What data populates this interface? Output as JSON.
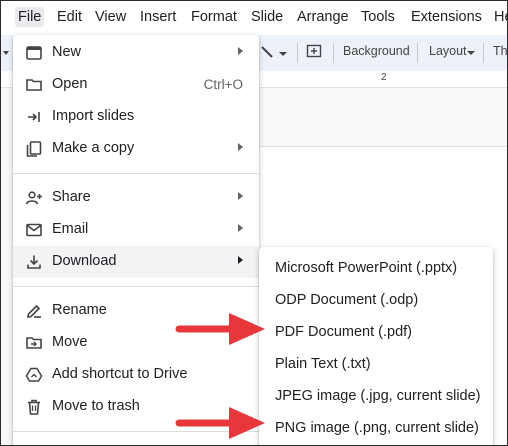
{
  "menubar": {
    "items": [
      "File",
      "Edit",
      "View",
      "Insert",
      "Format",
      "Slide",
      "Arrange",
      "Tools",
      "Extensions",
      "He"
    ]
  },
  "toolbar": {
    "background_label": "Background",
    "layout_label": "Layout",
    "theme_label": "Th",
    "ruler_mark": "2"
  },
  "file_menu": {
    "items": [
      {
        "label": "New",
        "icon": "new-slide-icon",
        "submenu": true
      },
      {
        "label": "Open",
        "icon": "folder-icon",
        "shortcut": "Ctrl+O"
      },
      {
        "label": "Import slides",
        "icon": "import-icon"
      },
      {
        "label": "Make a copy",
        "icon": "copy-icon",
        "submenu": true
      },
      {
        "label": "Share",
        "icon": "share-person-icon",
        "submenu": true
      },
      {
        "label": "Email",
        "icon": "email-icon",
        "submenu": true
      },
      {
        "label": "Download",
        "icon": "download-icon",
        "submenu": true,
        "highlighted": true
      },
      {
        "label": "Rename",
        "icon": "rename-icon"
      },
      {
        "label": "Move",
        "icon": "move-folder-icon"
      },
      {
        "label": "Add shortcut to Drive",
        "icon": "drive-shortcut-icon"
      },
      {
        "label": "Move to trash",
        "icon": "trash-icon"
      }
    ]
  },
  "download_submenu": {
    "items": [
      "Microsoft PowerPoint (.pptx)",
      "ODP Document (.odp)",
      "PDF Document (.pdf)",
      "Plain Text (.txt)",
      "JPEG image (.jpg, current slide)",
      "PNG image (.png, current slide)"
    ]
  },
  "colors": {
    "annotation_arrow": "#e8373a",
    "hover_bg": "#f1f3f4",
    "toolbar_bg": "#edf2fa"
  }
}
